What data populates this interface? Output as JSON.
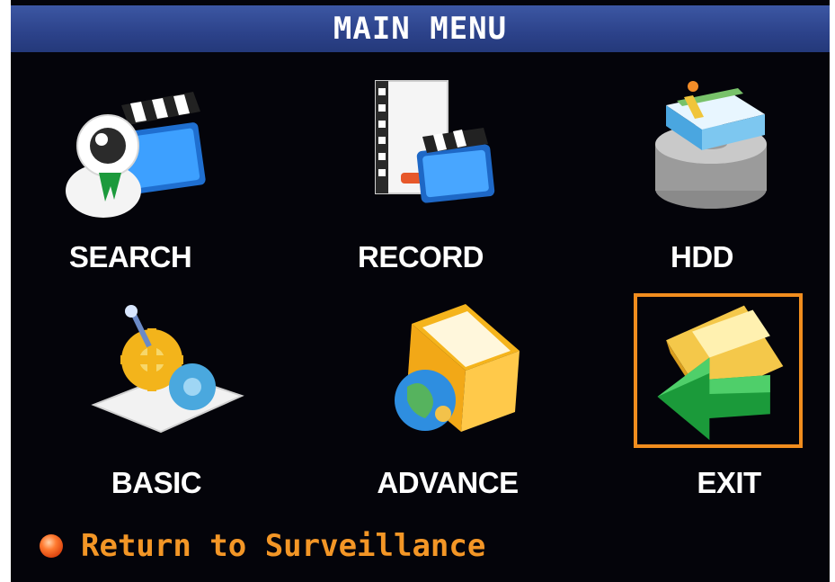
{
  "title": "MAIN MENU",
  "menu": {
    "items": [
      {
        "label": "SEARCH",
        "icon": "search-icon"
      },
      {
        "label": "RECORD",
        "icon": "record-icon"
      },
      {
        "label": "HDD",
        "icon": "hdd-icon"
      },
      {
        "label": "BASIC",
        "icon": "basic-settings-icon"
      },
      {
        "label": "ADVANCE",
        "icon": "advance-settings-icon"
      },
      {
        "label": "EXIT",
        "icon": "exit-icon",
        "selected": true
      }
    ]
  },
  "footer": {
    "label": "Return to Surveillance"
  },
  "colors": {
    "title_bar": "#2c428a",
    "background": "#04040a",
    "selection_frame": "#f18d1e",
    "footer_text": "#f39626",
    "label_text": "#ffffff"
  }
}
